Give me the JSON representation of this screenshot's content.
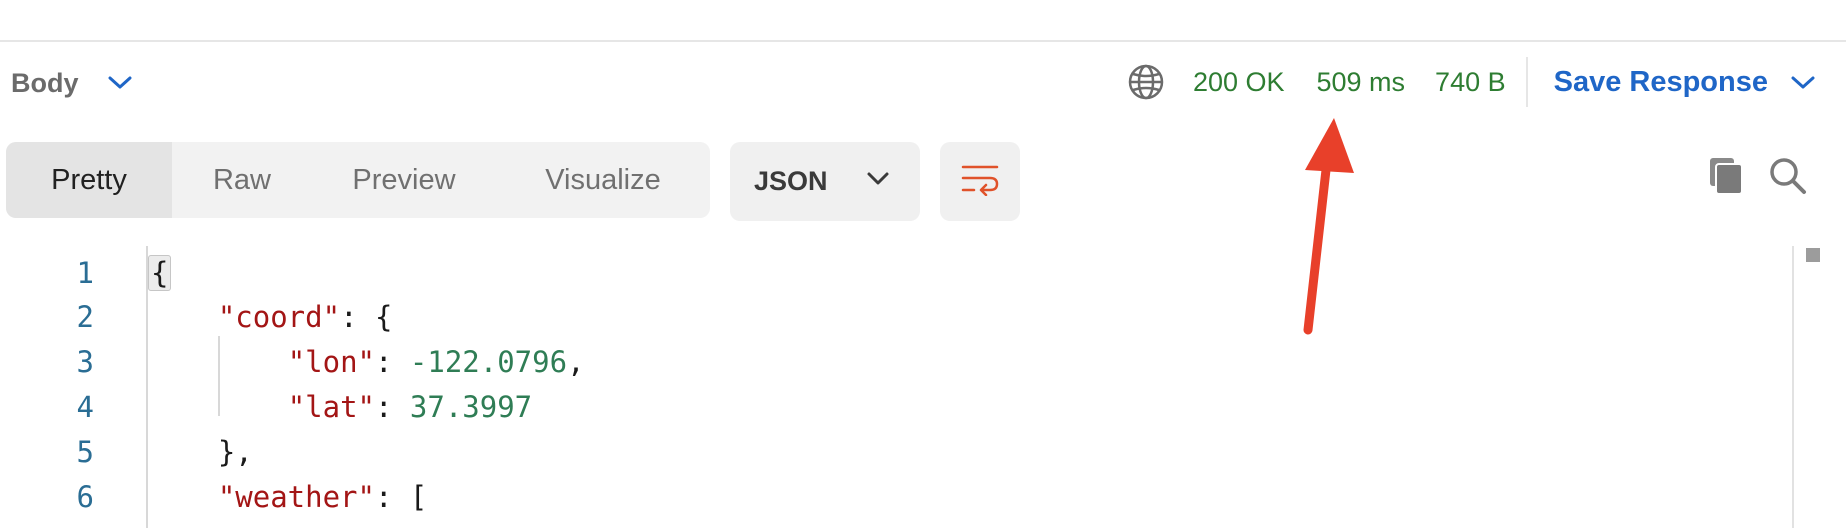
{
  "header": {
    "body_label": "Body",
    "status": {
      "code": "200 OK",
      "time": "509 ms",
      "size": "740 B"
    },
    "save_label": "Save Response",
    "status_color": "#2e7d32",
    "accent_color": "#1f66c7"
  },
  "toolbar": {
    "tabs": [
      {
        "label": "Pretty",
        "active": true
      },
      {
        "label": "Raw",
        "active": false
      },
      {
        "label": "Preview",
        "active": false
      },
      {
        "label": "Visualize",
        "active": false
      }
    ],
    "format": "JSON",
    "icons": [
      "wrap-lines-icon",
      "copy-icon",
      "search-icon",
      "globe-icon",
      "chevron-down-icon"
    ]
  },
  "annotation": {
    "arrow_color": "#e8402a",
    "points_to": "response-time"
  },
  "editor": {
    "lines": [
      {
        "num": "1",
        "indent": "",
        "key": "",
        "sep": "",
        "value": "",
        "punct": "{"
      },
      {
        "num": "2",
        "indent": "    ",
        "key": "\"coord\"",
        "sep": ": ",
        "value": "",
        "punct": "{"
      },
      {
        "num": "3",
        "indent": "        ",
        "key": "\"lon\"",
        "sep": ": ",
        "value": "-122.0796",
        "punct": ","
      },
      {
        "num": "4",
        "indent": "        ",
        "key": "\"lat\"",
        "sep": ": ",
        "value": "37.3997",
        "punct": ""
      },
      {
        "num": "5",
        "indent": "    ",
        "key": "",
        "sep": "",
        "value": "",
        "punct": "},"
      },
      {
        "num": "6",
        "indent": "    ",
        "key": "\"weather\"",
        "sep": ": ",
        "value": "",
        "punct": "["
      }
    ]
  }
}
